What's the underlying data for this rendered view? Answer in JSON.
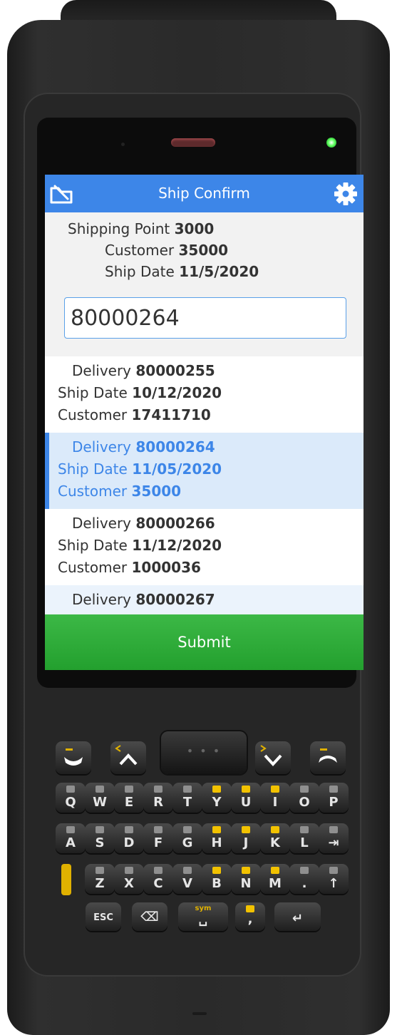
{
  "header": {
    "title": "Ship Confirm"
  },
  "info": {
    "shipping_point_label": "Shipping Point",
    "shipping_point_value": "3000",
    "customer_label": "Customer",
    "customer_value": "35000",
    "ship_date_label": "Ship Date",
    "ship_date_value": "11/5/2020"
  },
  "scan_input": {
    "value": "80000264"
  },
  "deliveries": [
    {
      "delivery_label": "Delivery",
      "delivery": "80000255",
      "ship_date_label": "Ship Date",
      "ship_date": "10/12/2020",
      "customer_label": "Customer",
      "customer": "17411710"
    },
    {
      "delivery_label": "Delivery",
      "delivery": "80000264",
      "ship_date_label": "Ship Date",
      "ship_date": "11/05/2020",
      "customer_label": "Customer",
      "customer": "35000"
    },
    {
      "delivery_label": "Delivery",
      "delivery": "80000266",
      "ship_date_label": "Ship Date",
      "ship_date": "11/12/2020",
      "customer_label": "Customer",
      "customer": "1000036"
    },
    {
      "delivery_label": "Delivery",
      "delivery": "80000267"
    }
  ],
  "submit_label": "Submit",
  "colors": {
    "header": "#3d86e8",
    "submit": "#2fad3a",
    "selected_row": "#dbeafa"
  },
  "keyboard": {
    "row1": [
      "Q",
      "W",
      "E",
      "R",
      "T",
      "Y",
      "U",
      "I",
      "O",
      "P"
    ],
    "row2": [
      "A",
      "S",
      "D",
      "F",
      "G",
      "H",
      "J",
      "K",
      "L"
    ],
    "row3": [
      "Z",
      "X",
      "C",
      "V",
      "B",
      "N",
      "M"
    ],
    "esc": "ESC",
    "sym": "sym"
  }
}
